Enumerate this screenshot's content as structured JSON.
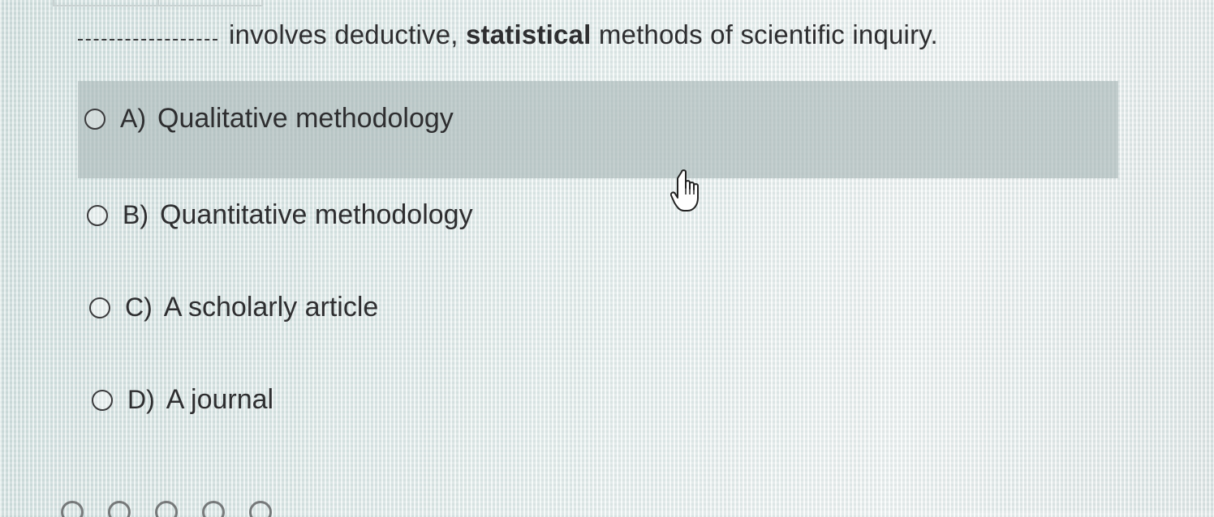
{
  "question": {
    "blank": "___________",
    "text_before_bold": "involves deductive, ",
    "text_bold": "statistical",
    "text_after_bold": " methods of scientific inquiry."
  },
  "options": [
    {
      "letter": "A)",
      "text": "Qualitative methodology",
      "highlighted": true,
      "selected": false
    },
    {
      "letter": "B)",
      "text": "Quantitative methodology",
      "highlighted": false,
      "selected": false
    },
    {
      "letter": "C)",
      "text": "A scholarly article",
      "highlighted": false,
      "selected": false
    },
    {
      "letter": "D)",
      "text": "A journal",
      "highlighted": false,
      "selected": false
    }
  ],
  "colors": {
    "text": "#2e2e30",
    "highlight": "#b0bebe",
    "background": "#d9e6e4"
  },
  "cursor": {
    "icon": "hand-pointer-icon"
  }
}
